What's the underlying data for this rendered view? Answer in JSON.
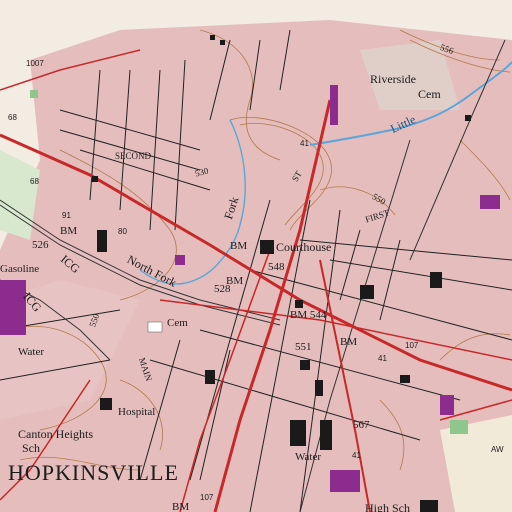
{
  "map": {
    "place_labels": {
      "city": "HOPKINSVILLE",
      "riverside_cem": "Riverside",
      "riverside_cem2": "Cem",
      "courthouse": "Courthouse",
      "hospital": "Hospital",
      "canton_heights": "Canton Heights",
      "canton_heights_sch": "Sch",
      "high_sch": "High Sch",
      "cem": "Cem",
      "gasoline": "Gasoline",
      "water_left": "Water",
      "water_bottom": "Water"
    },
    "street_labels": {
      "second": "SECOND",
      "first": "FIRST",
      "main": "MAIN",
      "st": "ST",
      "bm": "BM",
      "bm_548": "BM",
      "bm_529": "BM",
      "bm_544": "BM 544",
      "bm_bottom": "BM",
      "bm_551": "BM"
    },
    "water_labels": {
      "north_fork": "North Fork",
      "little": "Little",
      "fork": "Fork"
    },
    "railroad_labels": {
      "icg_left": "ICG",
      "icg_bottom": "ICG"
    },
    "elevations": {
      "e526": "526",
      "e528": "528",
      "e548": "548",
      "e551": "551",
      "e567": "567",
      "e530": "530",
      "e550": "550",
      "e550b": "550",
      "e556": "556"
    },
    "routes": {
      "r1007": "1007",
      "r68": "68",
      "r91": "91",
      "r80": "80",
      "r41": "41",
      "r107": "107",
      "r107b": "107",
      "r41b": "41",
      "r41c": "41",
      "aw": "AW"
    },
    "colors": {
      "urban_tint": "#e5bdbd",
      "contour": "#b07a4a",
      "road": "#c82828",
      "water": "#5aa6d8",
      "purple": "#8d2c8f",
      "building": "#1a1a1a",
      "green": "#8fc68b"
    }
  }
}
